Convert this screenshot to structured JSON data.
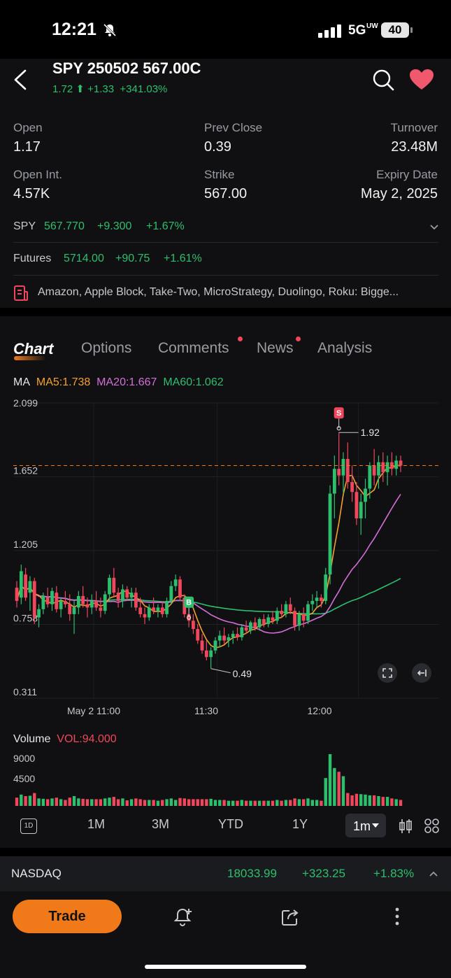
{
  "status": {
    "time": "12:21",
    "network": "5G",
    "network_sub": "UW",
    "battery": "40"
  },
  "header": {
    "title": "SPY 250502 567.00C",
    "price": "1.72",
    "change": "+1.33",
    "change_pct": "+341.03%"
  },
  "stats": [
    {
      "label": "Open",
      "value": "1.17"
    },
    {
      "label": "Prev Close",
      "value": "0.39"
    },
    {
      "label": "Turnover",
      "value": "23.48M"
    },
    {
      "label": "Open Int.",
      "value": "4.57K"
    },
    {
      "label": "Strike",
      "value": "567.00"
    },
    {
      "label": "Expiry Date",
      "value": "May 2, 2025"
    }
  ],
  "underlying": {
    "label": "SPY",
    "price": "567.770",
    "change": "+9.300",
    "change_pct": "+1.67%"
  },
  "futures": {
    "label": "Futures",
    "price": "5714.00",
    "change": "+90.75",
    "change_pct": "+1.61%"
  },
  "news_ticker": "Amazon, Apple Block, Take-Two, MicroStrategy, Duolingo, Roku: Bigge...",
  "tabs": [
    "Chart",
    "Options",
    "Comments",
    "News",
    "Analysis"
  ],
  "ma": {
    "label": "MA",
    "ma5": "MA5:1.738",
    "ma20": "MA20:1.667",
    "ma60": "MA60:1.062"
  },
  "colors": {
    "up": "#2dbf6e",
    "down": "#f0475c",
    "ma5": "#f4a12f",
    "ma20": "#d46fd8",
    "ma60": "#2dbf6e",
    "accent": "#f07a1a"
  },
  "chart_data": {
    "type": "candlestick",
    "y_ticks": [
      "2.099",
      "1.652",
      "1.205",
      "0.758",
      "0.311"
    ],
    "x_ticks": [
      "May 2 11:00",
      "11:30",
      "12:00"
    ],
    "ylim": [
      0.311,
      2.099
    ],
    "current_price_line": 1.72,
    "high_marker": "1.92",
    "low_marker": "0.49",
    "signals": [
      {
        "label": "B"
      },
      {
        "label": "S"
      }
    ],
    "ohlc": [
      [
        0.98,
        1.02,
        0.86,
        0.9
      ],
      [
        0.92,
        1.12,
        0.88,
        1.08
      ],
      [
        1.06,
        1.1,
        0.9,
        0.92
      ],
      [
        0.95,
        1.05,
        0.84,
        1.02
      ],
      [
        1.02,
        1.04,
        0.76,
        0.8
      ],
      [
        0.8,
        0.88,
        0.74,
        0.85
      ],
      [
        0.85,
        0.95,
        0.82,
        0.93
      ],
      [
        0.92,
        0.98,
        0.86,
        0.88
      ],
      [
        0.88,
        0.98,
        0.84,
        0.96
      ],
      [
        0.95,
        0.99,
        0.83,
        0.85
      ],
      [
        0.85,
        0.92,
        0.8,
        0.9
      ],
      [
        0.9,
        0.96,
        0.86,
        0.88
      ],
      [
        0.88,
        0.94,
        0.78,
        0.82
      ],
      [
        0.82,
        0.9,
        0.7,
        0.86
      ],
      [
        0.86,
        0.96,
        0.82,
        0.93
      ],
      [
        0.93,
        0.99,
        0.86,
        0.88
      ],
      [
        0.88,
        0.92,
        0.8,
        0.86
      ],
      [
        0.86,
        0.94,
        0.82,
        0.9
      ],
      [
        0.9,
        0.96,
        0.84,
        0.86
      ],
      [
        0.86,
        0.92,
        0.8,
        0.84
      ],
      [
        0.84,
        0.96,
        0.82,
        0.94
      ],
      [
        0.94,
        1.06,
        0.9,
        1.04
      ],
      [
        1.04,
        1.1,
        0.92,
        0.95
      ],
      [
        0.95,
        0.98,
        0.86,
        0.9
      ],
      [
        0.9,
        1.0,
        0.86,
        0.97
      ],
      [
        0.97,
        0.99,
        0.9,
        0.92
      ],
      [
        0.92,
        0.98,
        0.86,
        0.95
      ],
      [
        0.95,
        0.98,
        0.84,
        0.86
      ],
      [
        0.86,
        0.92,
        0.8,
        0.82
      ],
      [
        0.82,
        0.86,
        0.76,
        0.8
      ],
      [
        0.8,
        0.88,
        0.78,
        0.86
      ],
      [
        0.86,
        0.92,
        0.82,
        0.84
      ],
      [
        0.84,
        0.88,
        0.8,
        0.86
      ],
      [
        0.86,
        0.9,
        0.8,
        0.82
      ],
      [
        0.82,
        0.92,
        0.8,
        0.9
      ],
      [
        0.9,
        1.02,
        0.88,
        0.99
      ],
      [
        0.99,
        1.06,
        0.96,
        1.03
      ],
      [
        1.03,
        1.05,
        0.9,
        0.92
      ],
      [
        0.92,
        0.94,
        0.8,
        0.82
      ],
      [
        0.82,
        0.86,
        0.74,
        0.78
      ],
      [
        0.78,
        0.82,
        0.7,
        0.73
      ],
      [
        0.73,
        0.76,
        0.64,
        0.66
      ],
      [
        0.66,
        0.7,
        0.58,
        0.6
      ],
      [
        0.6,
        0.66,
        0.54,
        0.56
      ],
      [
        0.56,
        0.62,
        0.49,
        0.6
      ],
      [
        0.6,
        0.68,
        0.58,
        0.66
      ],
      [
        0.66,
        0.72,
        0.62,
        0.69
      ],
      [
        0.69,
        0.74,
        0.64,
        0.66
      ],
      [
        0.66,
        0.7,
        0.62,
        0.68
      ],
      [
        0.68,
        0.72,
        0.64,
        0.7
      ],
      [
        0.7,
        0.74,
        0.66,
        0.68
      ],
      [
        0.68,
        0.76,
        0.66,
        0.74
      ],
      [
        0.74,
        0.78,
        0.7,
        0.72
      ],
      [
        0.72,
        0.78,
        0.7,
        0.77
      ],
      [
        0.77,
        0.8,
        0.72,
        0.74
      ],
      [
        0.74,
        0.8,
        0.72,
        0.79
      ],
      [
        0.79,
        0.82,
        0.74,
        0.76
      ],
      [
        0.76,
        0.82,
        0.74,
        0.8
      ],
      [
        0.8,
        0.84,
        0.76,
        0.78
      ],
      [
        0.78,
        0.86,
        0.76,
        0.84
      ],
      [
        0.84,
        0.88,
        0.8,
        0.82
      ],
      [
        0.82,
        0.9,
        0.8,
        0.88
      ],
      [
        0.88,
        0.92,
        0.82,
        0.84
      ],
      [
        0.84,
        0.86,
        0.72,
        0.75
      ],
      [
        0.75,
        0.84,
        0.72,
        0.82
      ],
      [
        0.82,
        0.86,
        0.74,
        0.78
      ],
      [
        0.78,
        0.9,
        0.76,
        0.88
      ],
      [
        0.88,
        0.94,
        0.84,
        0.9
      ],
      [
        0.9,
        0.96,
        0.86,
        0.92
      ],
      [
        0.92,
        0.94,
        0.86,
        0.9
      ],
      [
        0.9,
        1.1,
        0.88,
        1.06
      ],
      [
        1.06,
        1.6,
        1.0,
        1.55
      ],
      [
        1.55,
        1.78,
        1.4,
        1.7
      ],
      [
        1.7,
        1.92,
        1.6,
        1.66
      ],
      [
        1.66,
        1.8,
        1.55,
        1.76
      ],
      [
        1.76,
        1.86,
        1.58,
        1.62
      ],
      [
        1.62,
        1.72,
        1.5,
        1.56
      ],
      [
        1.56,
        1.62,
        1.36,
        1.4
      ],
      [
        1.4,
        1.55,
        1.3,
        1.5
      ],
      [
        1.5,
        1.64,
        1.4,
        1.58
      ],
      [
        1.58,
        1.74,
        1.52,
        1.72
      ],
      [
        1.72,
        1.82,
        1.6,
        1.66
      ],
      [
        1.66,
        1.78,
        1.58,
        1.74
      ],
      [
        1.74,
        1.8,
        1.62,
        1.68
      ],
      [
        1.68,
        1.78,
        1.6,
        1.74
      ],
      [
        1.74,
        1.8,
        1.66,
        1.7
      ],
      [
        1.7,
        1.78,
        1.66,
        1.75
      ],
      [
        1.75,
        1.78,
        1.68,
        1.72
      ]
    ],
    "volume_axis": [
      "9000",
      "4500"
    ],
    "volume_label": "Volume",
    "vol_value": "VOL:94.000"
  },
  "timeframes": [
    "1D",
    "1M",
    "3M",
    "YTD",
    "1Y",
    "1m"
  ],
  "index_bar": {
    "name": "NASDAQ",
    "value": "18033.99",
    "change": "+323.25",
    "change_pct": "+1.83%"
  },
  "bottom": {
    "trade_label": "Trade"
  }
}
